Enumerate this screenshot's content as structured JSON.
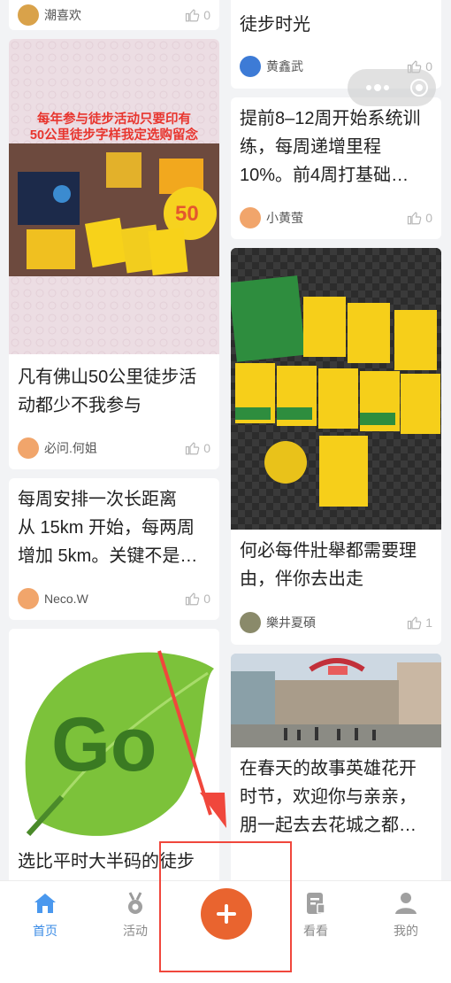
{
  "feed": {
    "left": [
      {
        "author": "潮喜欢",
        "likes": "0"
      },
      {
        "banner": "每年参与徒步活动只要印有\n50公里徒步字样我定选购留念",
        "title_l1": "凡有佛山50公里徒步活",
        "title_l2": "动都少不我参与",
        "author": "必问.何姐",
        "likes": "0"
      },
      {
        "title_l1": "每周安排一次长距离",
        "title_l2": "从 15km 开始，每两周",
        "title_l3": "增加 5km。关键不是…",
        "author": "Neco.W",
        "likes": "0"
      },
      {
        "title_l1": "选比平时大半码的徒步"
      }
    ],
    "right": [
      {
        "title_l1": "徒步时光",
        "author": "黄鑫武",
        "likes": "0"
      },
      {
        "title_l1": "提前8–12周开始系统训",
        "title_l2": "练，每周递增里程",
        "title_l3": "10%。前4周打基础…",
        "author": "小黄萤",
        "likes": "0"
      },
      {
        "title_l1": "何必每件壯舉都需要理",
        "title_l2": "由，伴你去出走",
        "author": "樂井夏碩",
        "likes": "1"
      },
      {
        "title_l1": "在春天的故事英雄花开",
        "title_l2": "时节，欢迎你与亲亲，",
        "title_l3": "朋一起去去花城之都…"
      }
    ]
  },
  "tabs": [
    {
      "label": "首页",
      "icon": "home-icon",
      "active": true
    },
    {
      "label": "活动",
      "icon": "medal-icon",
      "active": false
    },
    {
      "label": "",
      "icon": "plus-icon",
      "active": false
    },
    {
      "label": "看看",
      "icon": "document-icon",
      "active": false
    },
    {
      "label": "我的",
      "icon": "user-icon",
      "active": false
    }
  ],
  "colors": {
    "accent": "#3a8be6",
    "plus_button": "#e9642f",
    "highlight_box": "#f0473c"
  }
}
